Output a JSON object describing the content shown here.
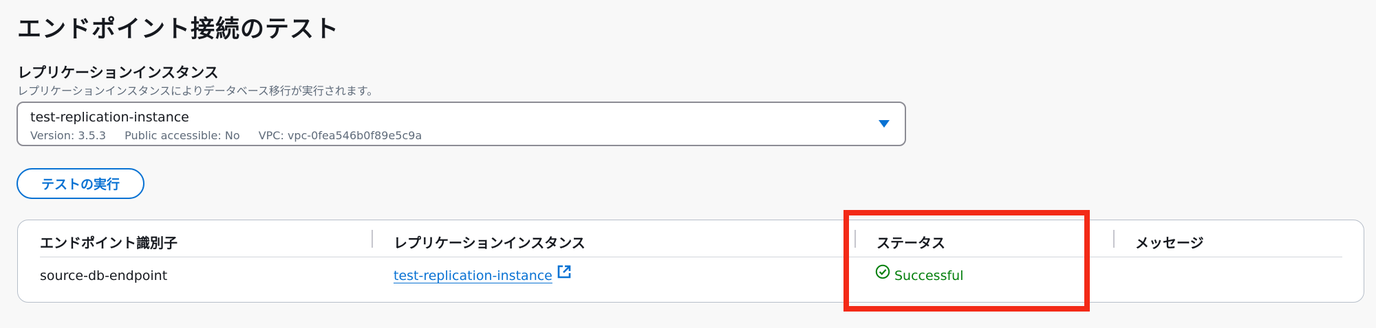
{
  "page": {
    "title": "エンドポイント接続のテスト"
  },
  "replication_field": {
    "label": "レプリケーションインスタンス",
    "description": "レプリケーションインスタンスによりデータベース移行が実行されます。",
    "selected": {
      "name": "test-replication-instance",
      "version": "Version: 3.5.3",
      "public_accessible": "Public accessible: No",
      "vpc": "VPC: vpc-0fea546b0f89e5c9a"
    }
  },
  "actions": {
    "run_test_label": "テストの実行"
  },
  "results_table": {
    "headers": [
      "エンドポイント識別子",
      "レプリケーションインスタンス",
      "ステータス",
      "メッセージ"
    ],
    "rows": [
      {
        "endpoint_id": "source-db-endpoint",
        "replication_instance": "test-replication-instance",
        "status": "Successful",
        "message": ""
      }
    ]
  },
  "colors": {
    "accent": "#0972d3",
    "success": "#037f0c",
    "highlight": "#f32a17"
  },
  "icons": {
    "dropdown": "caret-down-icon",
    "external_link": "external-link-icon",
    "status": "check-circle-icon"
  }
}
